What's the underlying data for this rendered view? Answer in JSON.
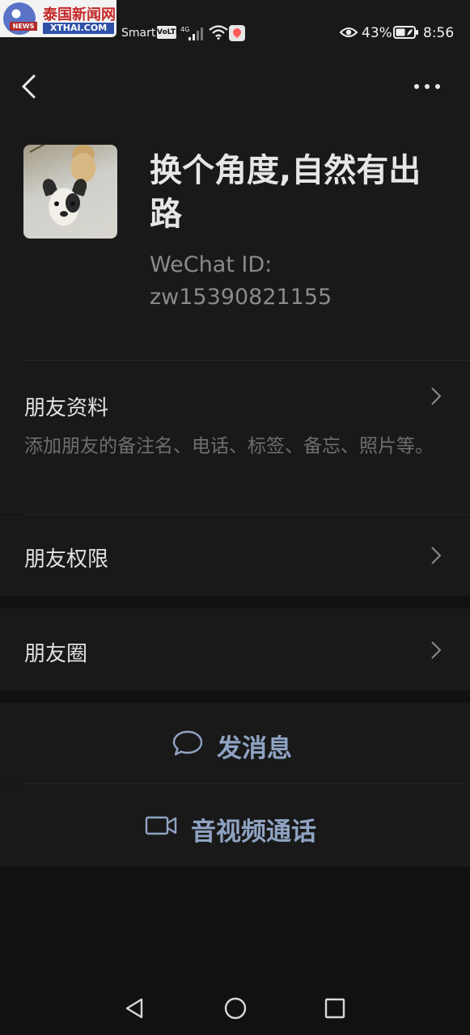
{
  "status_bar": {
    "logo_cn": "泰国新闻网",
    "logo_en": "XTHAI.COM",
    "logo_badge": "NEWS",
    "carrier": "Smart",
    "volte": "VoLTE",
    "network": "4G",
    "battery": "43%",
    "time": "8:56"
  },
  "profile": {
    "name": "换个角度,自然有出路",
    "wechat_id_label": "WeChat ID:",
    "wechat_id": "zw15390821155"
  },
  "menu": [
    {
      "label": "朋友资料",
      "desc": "添加朋友的备注名、电话、标签、备忘、照片等。"
    },
    {
      "label": "朋友权限"
    },
    {
      "label": "朋友圈"
    }
  ],
  "actions": {
    "message": "发消息",
    "call": "音视频通话"
  },
  "icons": {
    "back": "back-arrow-icon",
    "more": "more-dots-icon",
    "chevron": "chevron-right-icon",
    "chat": "chat-bubble-icon",
    "video": "video-camera-icon",
    "nav_back": "triangle-back-icon",
    "nav_home": "circle-home-icon",
    "nav_recent": "square-recents-icon"
  },
  "colors": {
    "background": "#111111",
    "surface": "#191919",
    "action_text": "#8fa3c3",
    "muted_text": "#6e6e6e"
  }
}
